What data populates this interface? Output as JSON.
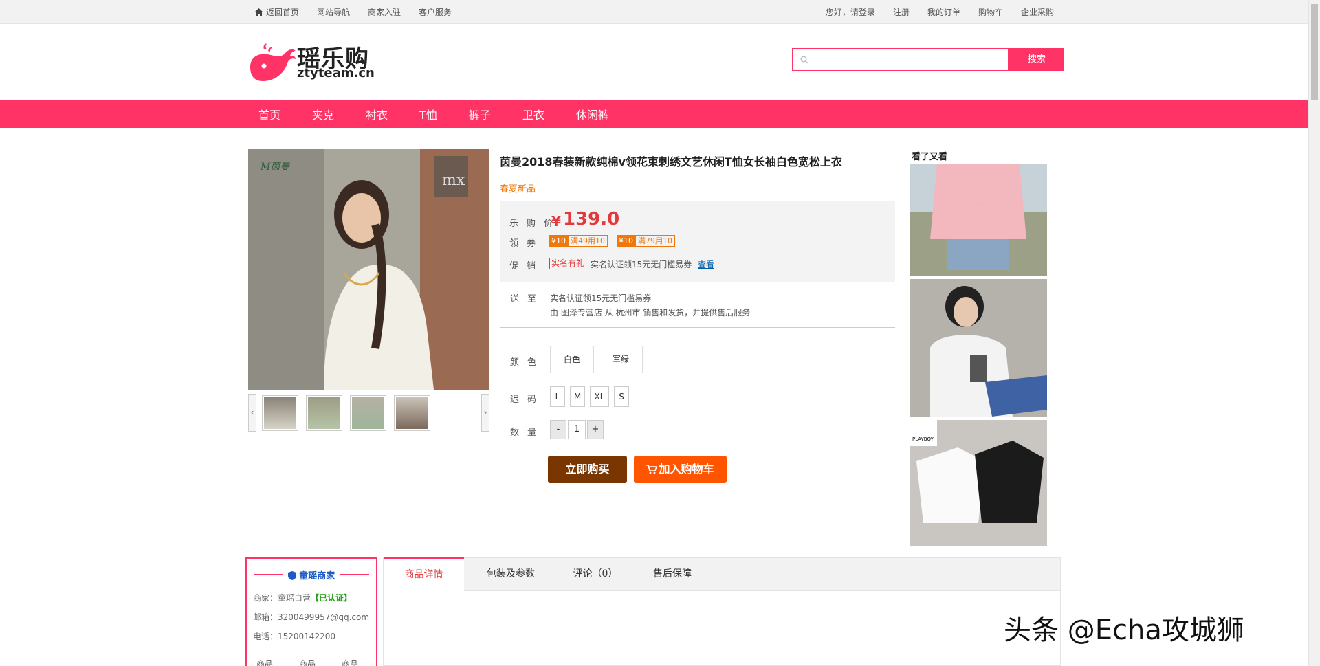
{
  "topbar": {
    "left": [
      "返回首页",
      "网站导航",
      "商家入驻",
      "客户服务"
    ],
    "right": [
      "您好，请登录",
      "注册",
      "我的订单",
      "购物车",
      "企业采购"
    ]
  },
  "logo": {
    "cn": "瑶乐购",
    "en": "ztyteam.cn"
  },
  "search": {
    "placeholder": "",
    "button": "搜索"
  },
  "nav": [
    "首页",
    "夹克",
    "衬衣",
    "T恤",
    "裤子",
    "卫衣",
    "休闲裤"
  ],
  "product": {
    "title": "茵曼2018春装新款纯棉v领花束刺绣文艺休闲T恤女长袖白色宽松上衣",
    "tag": "春夏新品",
    "price_label": "乐购价",
    "price_symbol": "¥",
    "price": "139.0",
    "coupon_label": "领券",
    "coupons": [
      {
        "amount": "¥10",
        "rule": "满49用10"
      },
      {
        "amount": "¥10",
        "rule": "满79用10"
      }
    ],
    "promo_label": "促销",
    "promo_badge": "实名有礼",
    "promo_text": "实名认证领15元无门槛易券",
    "promo_link": "查看",
    "ship_label": "送至",
    "ship_line1": "实名认证领15元无门槛易券",
    "ship_line2": "由 图泽专营店 从 杭州市 销售和发货，并提供售后服务",
    "color_label": "颜色",
    "colors": [
      "白色",
      "军绿"
    ],
    "size_label": "迟码",
    "sizes": [
      "L",
      "M",
      "XL",
      "S"
    ],
    "qty_label": "数量",
    "qty_minus": "-",
    "qty_value": "1",
    "qty_plus": "+",
    "buy_now": "立即购买",
    "add_cart": "加入购物车"
  },
  "gallery": {
    "prev": "‹",
    "next": "›",
    "main_logo": "M茵曼",
    "sign": "mx"
  },
  "look_again": {
    "title": "看了又看",
    "brand": "PLAYBOY"
  },
  "merchant": {
    "title": "童瑶商家",
    "merchant_prefix": "商家：",
    "merchant_name": "童瑶自营",
    "verified": "【已认证】",
    "email": "邮箱：3200499957@qq.com",
    "phone": "电话：15200142200",
    "stats": [
      "商品",
      "商品",
      "商品"
    ]
  },
  "tabs": [
    "商品详情",
    "包装及参数",
    "评论（0）",
    "售后保障"
  ],
  "watermark": "头条 @Echa攻城狮",
  "colors": {
    "accent": "#ff3366",
    "price": "#e4393c",
    "buy": "#7a3600",
    "cart": "#ff5500"
  }
}
